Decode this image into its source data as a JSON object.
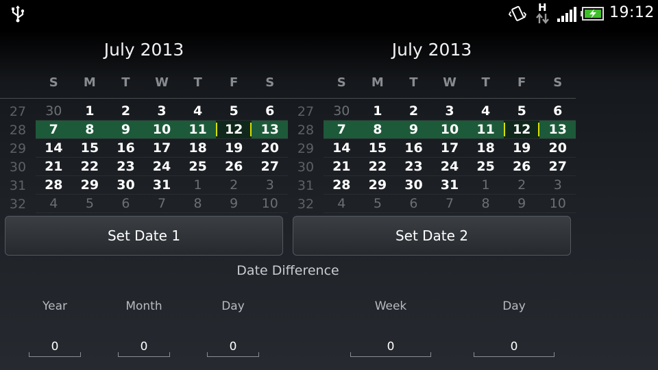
{
  "status_bar": {
    "time": "19:12",
    "network": "H",
    "icons": [
      "usb-icon",
      "vibrate-icon",
      "hplus-data-icon",
      "signal-icon",
      "battery-charging-icon"
    ]
  },
  "colors": {
    "selected_week_bg": "#1d5a3a",
    "today_marker": "#d9e000",
    "background_dark": "#000000"
  },
  "calendars": [
    {
      "title": "July 2013",
      "dow": [
        "S",
        "M",
        "T",
        "W",
        "T",
        "F",
        "S"
      ],
      "weeks": [
        {
          "num": "27",
          "days": [
            "30",
            "1",
            "2",
            "3",
            "4",
            "5",
            "6"
          ],
          "other": [
            0
          ]
        },
        {
          "num": "28",
          "days": [
            "7",
            "8",
            "9",
            "10",
            "11",
            "12",
            "13"
          ],
          "selected": true,
          "today": 5
        },
        {
          "num": "29",
          "days": [
            "14",
            "15",
            "16",
            "17",
            "18",
            "19",
            "20"
          ]
        },
        {
          "num": "30",
          "days": [
            "21",
            "22",
            "23",
            "24",
            "25",
            "26",
            "27"
          ]
        },
        {
          "num": "31",
          "days": [
            "28",
            "29",
            "30",
            "31",
            "1",
            "2",
            "3"
          ],
          "other": [
            4,
            5,
            6
          ]
        },
        {
          "num": "32",
          "days": [
            "4",
            "5",
            "6",
            "7",
            "8",
            "9",
            "10"
          ],
          "other": [
            0,
            1,
            2,
            3,
            4,
            5,
            6
          ]
        }
      ],
      "button_label": "Set Date 1"
    },
    {
      "title": "July 2013",
      "dow": [
        "S",
        "M",
        "T",
        "W",
        "T",
        "F",
        "S"
      ],
      "weeks": [
        {
          "num": "27",
          "days": [
            "30",
            "1",
            "2",
            "3",
            "4",
            "5",
            "6"
          ],
          "other": [
            0
          ]
        },
        {
          "num": "28",
          "days": [
            "7",
            "8",
            "9",
            "10",
            "11",
            "12",
            "13"
          ],
          "selected": true,
          "today": 5
        },
        {
          "num": "29",
          "days": [
            "14",
            "15",
            "16",
            "17",
            "18",
            "19",
            "20"
          ]
        },
        {
          "num": "30",
          "days": [
            "21",
            "22",
            "23",
            "24",
            "25",
            "26",
            "27"
          ]
        },
        {
          "num": "31",
          "days": [
            "28",
            "29",
            "30",
            "31",
            "1",
            "2",
            "3"
          ],
          "other": [
            4,
            5,
            6
          ]
        },
        {
          "num": "32",
          "days": [
            "4",
            "5",
            "6",
            "7",
            "8",
            "9",
            "10"
          ],
          "other": [
            0,
            1,
            2,
            3,
            4,
            5,
            6
          ]
        }
      ],
      "button_label": "Set Date 2"
    }
  ],
  "difference": {
    "title": "Date Difference",
    "fields": [
      {
        "label": "Year",
        "value": "0"
      },
      {
        "label": "Month",
        "value": "0"
      },
      {
        "label": "Day",
        "value": "0"
      },
      {
        "label": "Week",
        "value": "0"
      },
      {
        "label": "Day",
        "value": "0"
      }
    ]
  }
}
